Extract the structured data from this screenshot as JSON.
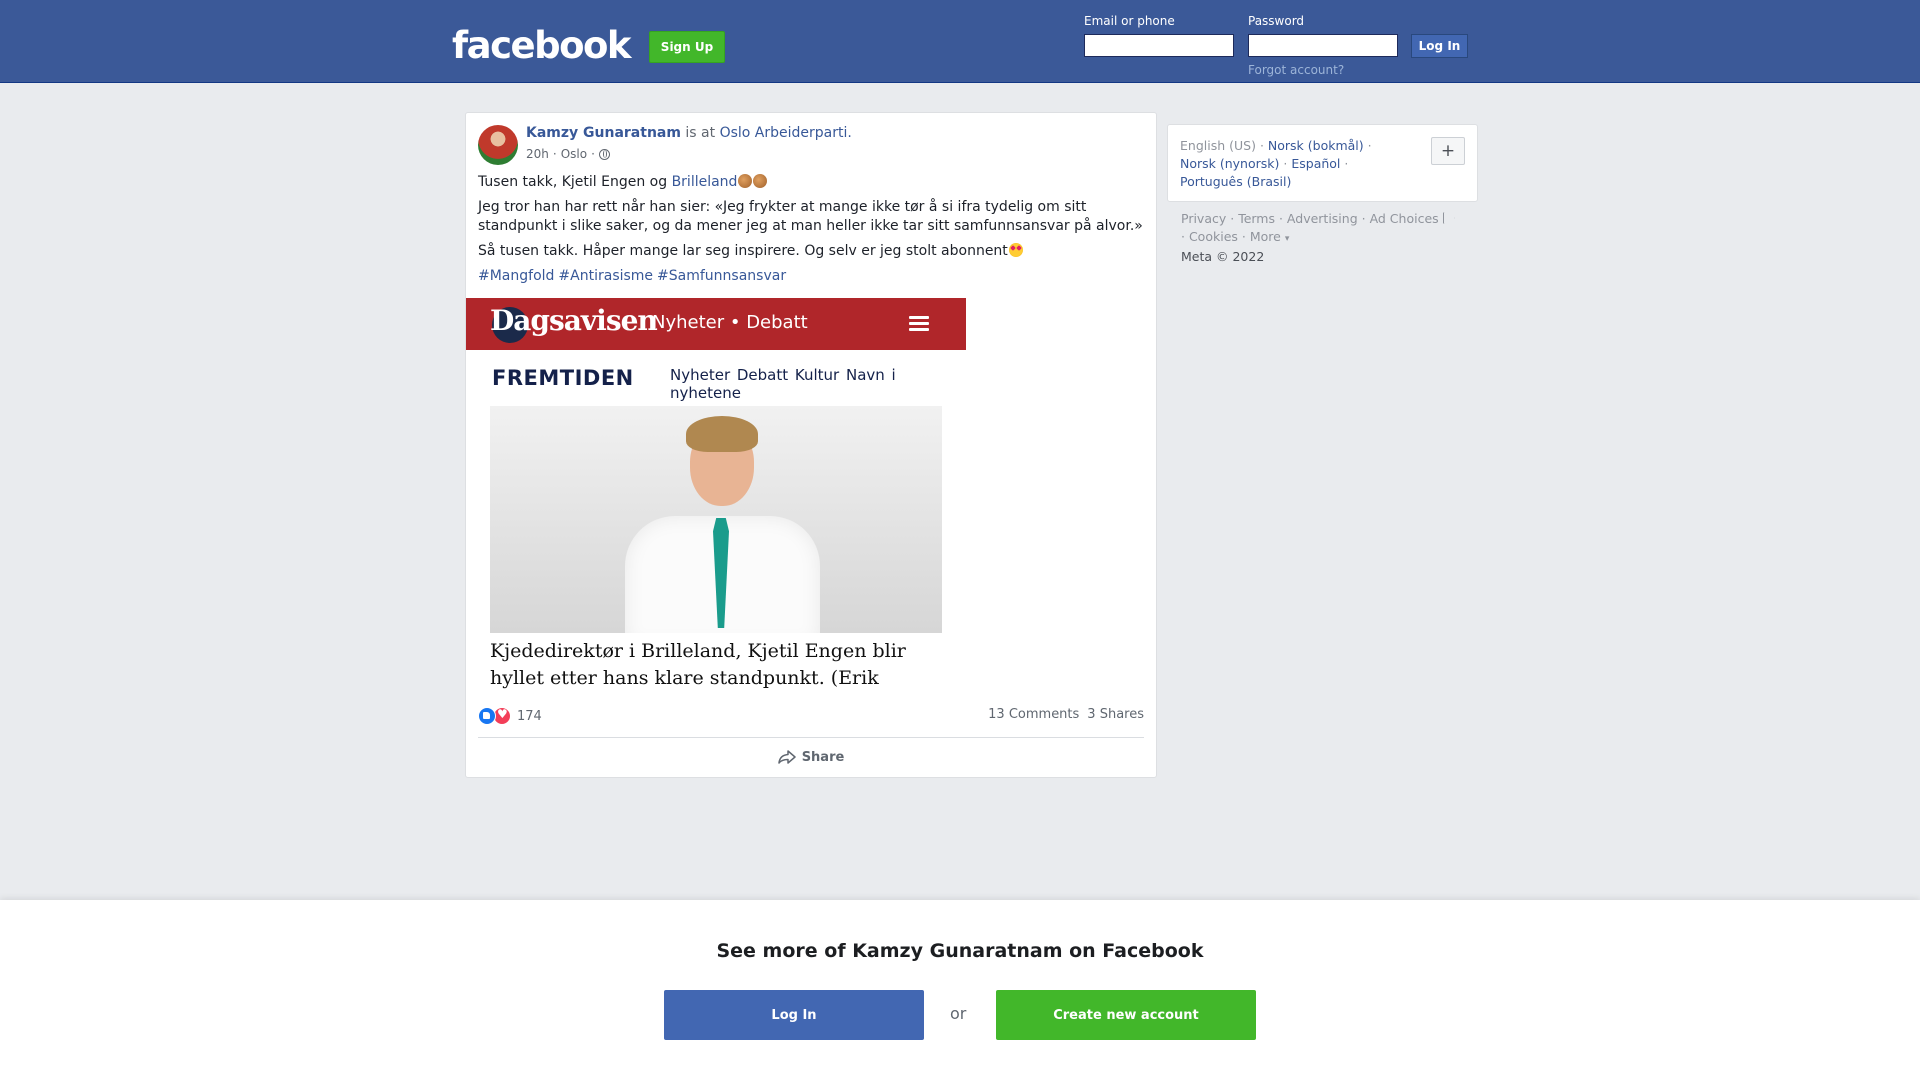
{
  "header": {
    "logo": "facebook",
    "signup_label": "Sign Up",
    "email_label": "Email or phone",
    "password_label": "Password",
    "login_label": "Log In",
    "forgot_label": "Forgot account?"
  },
  "post": {
    "author": "Kamzy Gunaratnam",
    "is_at": "is at",
    "place": "Oslo Arbeiderparti.",
    "time": "20h",
    "location": "Oslo",
    "privacy_icon": "globe-icon",
    "line1_prefix": "Tusen takk, Kjetil Engen og",
    "line1_link": "Brilleland",
    "line2": "Jeg tror han har rett når han sier: «Jeg frykter at mange ikke tør å si ifra tydelig om sitt standpunkt i slike saker, og da mener jeg at man heller ikke tar sitt samfunnsansvar på alvor.»",
    "line3": "Så tusen takk. Håper mange lar seg inspirere. Og selv er jeg stolt abonnent",
    "hashtags": [
      "#Mangfold",
      "#Antirasisme",
      "#Samfunnsansvar"
    ],
    "image": {
      "brand": "Dagsavisen",
      "brand_nav": "Nyheter  •  Debatt",
      "section": "FREMTIDEN",
      "section_nav": "Nyheter  Debatt  Kultur  Navn i nyhetene",
      "caption": "Kjededirektør i Brilleland, Kjetil Engen blir hyllet etter hans klare standpunkt. (Erik Haslestad )"
    },
    "reaction_count": "174",
    "comments": "13 Comments",
    "shares": "3 Shares",
    "share_label": "Share"
  },
  "languages": {
    "current": "English (US)",
    "others": [
      "Norsk (bokmål)",
      "Norsk (nynorsk)",
      "Español",
      "Português (Brasil)"
    ],
    "more_icon": "+"
  },
  "footer": {
    "links": [
      "Privacy",
      "Terms",
      "Advertising",
      "Ad Choices",
      "Cookies",
      "More"
    ],
    "copyright": "Meta © 2022"
  },
  "bottom": {
    "title": "See more of Kamzy Gunaratnam on Facebook",
    "login_label": "Log In",
    "or_label": "or",
    "create_label": "Create new account"
  },
  "colors": {
    "brand_blue": "#3b5998",
    "button_green": "#42b72a",
    "link_blue": "#385898",
    "dagsavisen_red": "#b0262a"
  }
}
